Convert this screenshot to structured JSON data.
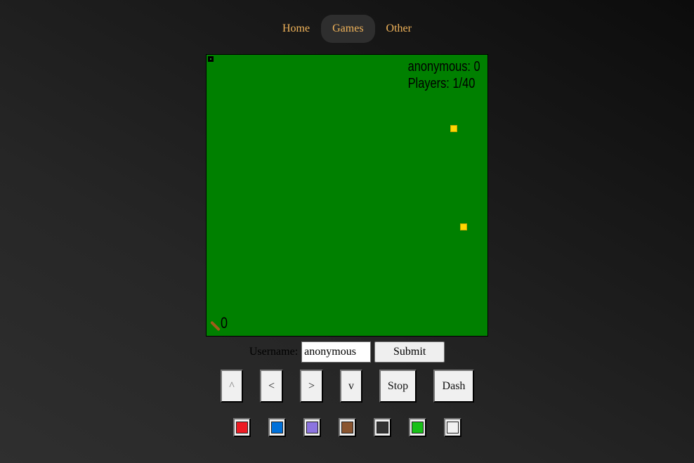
{
  "nav": {
    "items": [
      {
        "label": "Home",
        "active": false
      },
      {
        "label": "Games",
        "active": true
      },
      {
        "label": "Other",
        "active": false
      }
    ]
  },
  "game": {
    "score_line": "anonymous: 0",
    "players_line": "Players: 1/40",
    "stick_count": "0",
    "background_color": "#008000",
    "food_color": "#ffd700"
  },
  "user": {
    "label": "Username:",
    "input_value": "anonymous",
    "submit_label": "Submit"
  },
  "controls": {
    "up": "^",
    "left": "<",
    "right": ">",
    "down": "v",
    "stop": "Stop",
    "dash": "Dash"
  },
  "colors": [
    {
      "name": "red",
      "hex": "#ed1c24"
    },
    {
      "name": "blue",
      "hex": "#0070d9"
    },
    {
      "name": "purple",
      "hex": "#8c74e0"
    },
    {
      "name": "brown",
      "hex": "#8a5530"
    },
    {
      "name": "dark-gray",
      "hex": "#333333"
    },
    {
      "name": "green",
      "hex": "#18c018"
    },
    {
      "name": "white",
      "hex": "#f2f2f2"
    }
  ]
}
